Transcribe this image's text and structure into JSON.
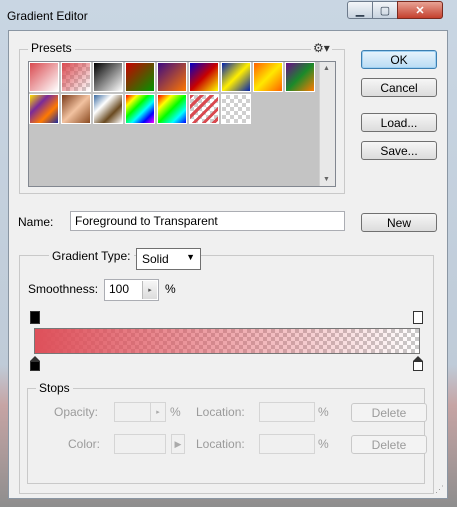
{
  "window": {
    "title": "Gradient Editor",
    "min": "▁",
    "max": "▢",
    "close": "✕"
  },
  "presets": {
    "label": "Presets",
    "menu_icon": "⚙▾",
    "swatches": [
      {
        "name": "foreground-to-background",
        "colors": [
          "#d94a50",
          "#ffffff"
        ]
      },
      {
        "name": "foreground-to-transparent",
        "colors": [
          "#d94a50",
          "transparent"
        ]
      },
      {
        "name": "black-white",
        "colors": [
          "#000000",
          "#ffffff"
        ]
      },
      {
        "name": "red-green",
        "colors": [
          "#c80000",
          "#009600"
        ]
      },
      {
        "name": "violet-orange",
        "colors": [
          "#3c0a82",
          "#ff7800"
        ]
      },
      {
        "name": "blue-red-yellow",
        "colors": [
          "#0000c8",
          "#c80000",
          "#ffff00"
        ]
      },
      {
        "name": "blue-yellow-blue",
        "colors": [
          "#0020b0",
          "#ffee00",
          "#0020b0"
        ]
      },
      {
        "name": "orange-yellow-orange",
        "colors": [
          "#ff6000",
          "#ffe800",
          "#ff6000"
        ]
      },
      {
        "name": "violet-green-orange",
        "colors": [
          "#6a0a8a",
          "#1a8a2a",
          "#ff7a00"
        ]
      },
      {
        "name": "yellow-violet-orange-blue",
        "colors": [
          "#ffe000",
          "#7a2a9a",
          "#ff7a00",
          "#1a2aa0"
        ]
      },
      {
        "name": "copper",
        "colors": [
          "#7a3a1a",
          "#f2c2a0",
          "#8a4a20"
        ]
      },
      {
        "name": "chrome",
        "colors": [
          "#3a6aa0",
          "#ffffff",
          "#6a4a20",
          "#ffffff"
        ]
      },
      {
        "name": "spectrum",
        "colors": [
          "#ff0000",
          "#ffff00",
          "#00ff00",
          "#00ffff",
          "#0000ff",
          "#ff00ff"
        ]
      },
      {
        "name": "transparent-rainbow",
        "colors": [
          "#ff0000",
          "#ffff00",
          "#00ff00",
          "#00ffff",
          "#0000ff"
        ]
      },
      {
        "name": "transparent-stripes",
        "colors": [
          "stripes"
        ]
      },
      {
        "name": "neutral-density",
        "colors": [
          "checker"
        ]
      }
    ]
  },
  "buttons": {
    "ok": "OK",
    "cancel": "Cancel",
    "load": "Load...",
    "save": "Save...",
    "new": "New"
  },
  "name_field": {
    "label": "Name:",
    "value": "Foreground to Transparent"
  },
  "gradient_type": {
    "label": "Gradient Type:",
    "value": "Solid"
  },
  "smoothness": {
    "label": "Smoothness:",
    "value": "100",
    "unit": "%",
    "spin": "▸"
  },
  "gradient": {
    "start_color": "#de505a",
    "end_color": "transparent"
  },
  "stops": {
    "label": "Stops",
    "opacity_label": "Opacity:",
    "opacity_unit": "%",
    "color_label": "Color:",
    "location_label": "Location:",
    "location_unit": "%",
    "delete_label": "Delete",
    "spin": "▸",
    "color_arrow": "▶"
  }
}
